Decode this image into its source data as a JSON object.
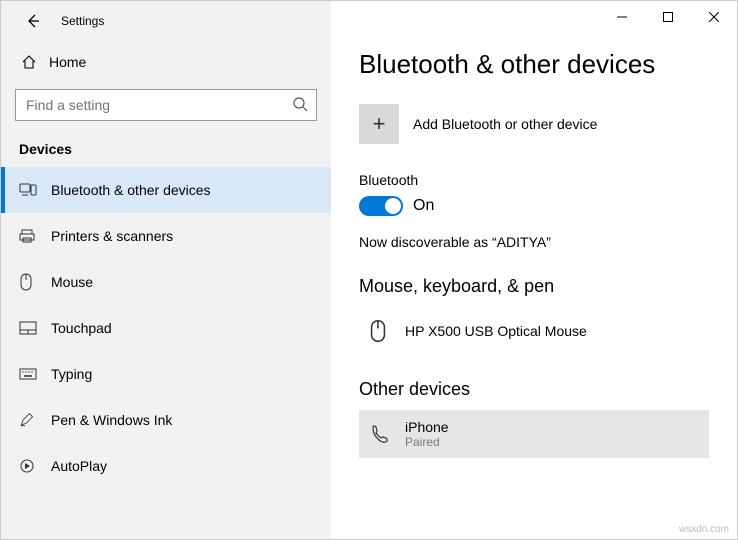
{
  "titlebar": {
    "title": "Settings"
  },
  "home": {
    "label": "Home"
  },
  "search": {
    "placeholder": "Find a setting"
  },
  "sidebar_section": "Devices",
  "nav": [
    {
      "label": "Bluetooth & other devices",
      "active": true
    },
    {
      "label": "Printers & scanners"
    },
    {
      "label": "Mouse"
    },
    {
      "label": "Touchpad"
    },
    {
      "label": "Typing"
    },
    {
      "label": "Pen & Windows Ink"
    },
    {
      "label": "AutoPlay"
    }
  ],
  "page": {
    "title": "Bluetooth & other devices",
    "add_label": "Add Bluetooth or other device",
    "bt_label": "Bluetooth",
    "toggle_state": "On",
    "discoverable": "Now discoverable as “ADITYA”",
    "mouse_section": "Mouse, keyboard, & pen",
    "mouse_device": "HP X500 USB Optical Mouse",
    "other_section": "Other devices",
    "other_device": {
      "name": "iPhone",
      "status": "Paired"
    }
  },
  "watermark": "wsxdn.com"
}
